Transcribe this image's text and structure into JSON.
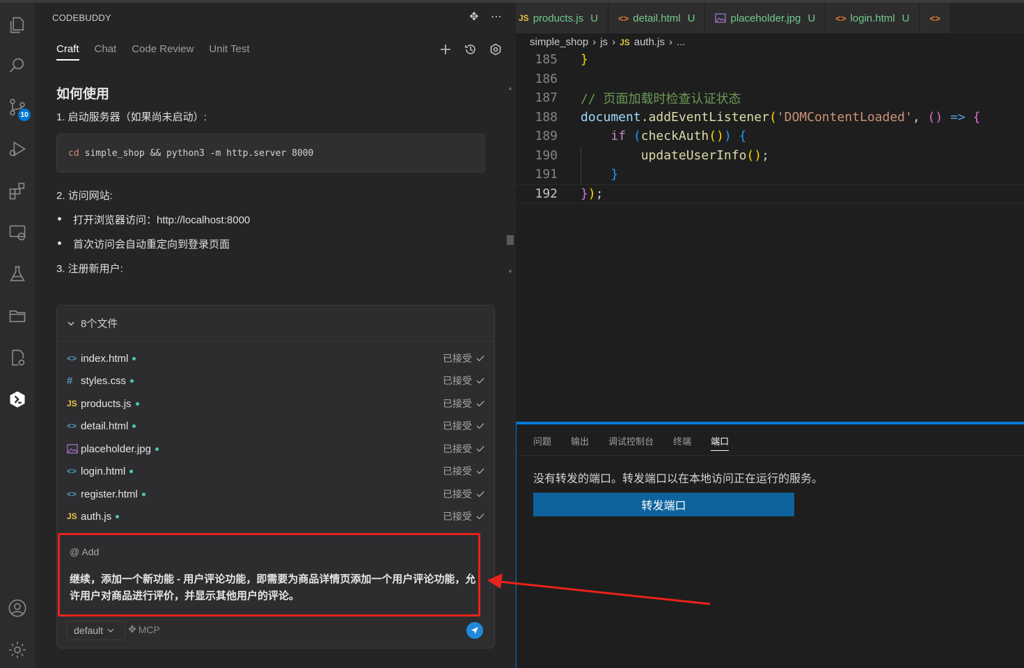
{
  "activity_bar": {
    "scm_badge": "10"
  },
  "sidebar": {
    "title": "CODEBUDDY",
    "tabs": [
      "Craft",
      "Chat",
      "Code Review",
      "Unit Test"
    ],
    "chat": {
      "heading": "如何使用",
      "step1": "1. 启动服务器（如果尚未启动）:",
      "code_cmd": "cd",
      "code_rest": "simple_shop && python3 -m http.server 8000",
      "step2": "2. 访问网站:",
      "bullet1": "打开浏览器访问：http://localhost:8000",
      "bullet2": "首次访问会自动重定向到登录页面",
      "step3": "3. 注册新用户:"
    },
    "files": {
      "header": "8个文件",
      "items": [
        {
          "name": "index.html",
          "icon": "<>",
          "status": "已接受"
        },
        {
          "name": "styles.css",
          "icon": "#",
          "status": "已接受"
        },
        {
          "name": "products.js",
          "icon": "JS",
          "status": "已接受"
        },
        {
          "name": "detail.html",
          "icon": "<>",
          "status": "已接受"
        },
        {
          "name": "placeholder.jpg",
          "icon": "img",
          "status": "已接受"
        },
        {
          "name": "login.html",
          "icon": "<>",
          "status": "已接受"
        },
        {
          "name": "register.html",
          "icon": "<>",
          "status": "已接受"
        },
        {
          "name": "auth.js",
          "icon": "JS",
          "status": "已接受"
        }
      ]
    },
    "input": {
      "at_add": "@ Add",
      "text": "继续，添加一个新功能 - 用户评论功能，即需要为商品详情页添加一个用户评论功能，允许用户对商品进行评价，并显示其他用户的评论。",
      "model": "default",
      "mcp": "MCP"
    }
  },
  "editor": {
    "tabs": [
      {
        "icon": "JS",
        "name": "products.js",
        "status": "U"
      },
      {
        "icon": "<>",
        "name": "detail.html",
        "status": "U"
      },
      {
        "icon": "img",
        "name": "placeholder.jpg",
        "status": "U"
      },
      {
        "icon": "<>",
        "name": "login.html",
        "status": "U"
      }
    ],
    "breadcrumb": [
      "simple_shop",
      "js",
      "auth.js",
      "..."
    ],
    "lines": [
      {
        "n": "185",
        "code": "}"
      },
      {
        "n": "186",
        "code": ""
      },
      {
        "n": "187",
        "code": "// 页面加载时检查认证状态"
      },
      {
        "n": "188",
        "code": "document.addEventListener('DOMContentLoaded', () => {"
      },
      {
        "n": "189",
        "code": "    if (checkAuth()) {"
      },
      {
        "n": "190",
        "code": "        updateUserInfo();"
      },
      {
        "n": "191",
        "code": "    }"
      },
      {
        "n": "192",
        "code": "});"
      }
    ]
  },
  "panel": {
    "tabs": [
      "问题",
      "输出",
      "调试控制台",
      "终端",
      "端口"
    ],
    "message": "没有转发的端口。转发端口以在本地访问正在运行的服务。",
    "button": "转发端口"
  },
  "colors": {
    "accent": "#0078d4",
    "highlight_box": "#e8231b",
    "untracked": "#73c991",
    "send_button": "#1f8ad9"
  }
}
